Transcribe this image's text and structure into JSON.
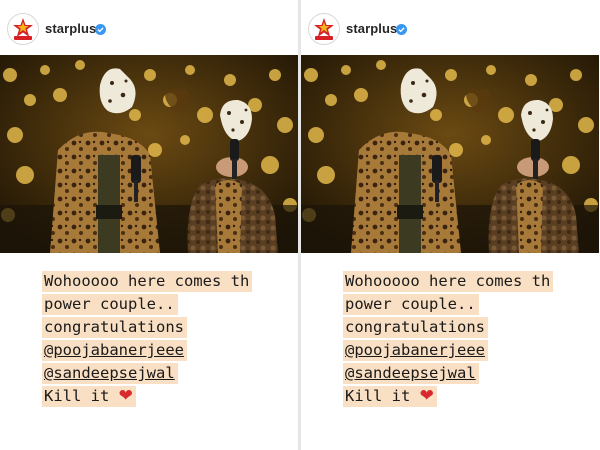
{
  "story": {
    "username": "starplus",
    "avatar_icon": "starplus-logo-icon",
    "verified_icon": "verified-badge-icon",
    "caption_lines": [
      "Wohooooo here comes th",
      "power couple..",
      "congratulations",
      "@poojabanerjeee",
      "@sandeepsejwal",
      "Kill it"
    ],
    "heart_emoji": "❤",
    "colors": {
      "highlight": "#f9dfc3",
      "verified": "#3897f0",
      "brand_red": "#d81f26",
      "photo_gold": "#c9a23a"
    }
  }
}
